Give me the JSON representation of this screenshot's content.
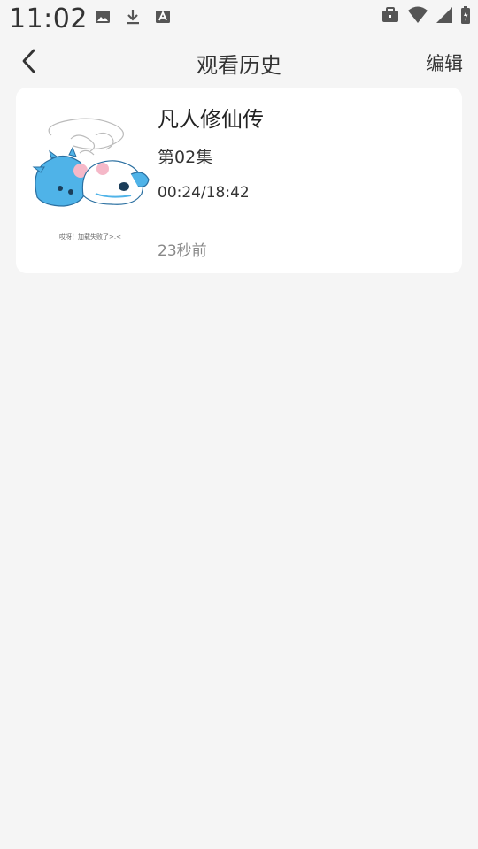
{
  "status_bar": {
    "time": "11:02",
    "left_icons": [
      "image-icon",
      "download-icon",
      "font-icon"
    ],
    "right_icons": [
      "briefcase-icon",
      "wifi-icon",
      "signal-icon",
      "battery-charging-icon"
    ]
  },
  "header": {
    "back_icon": "chevron-left-icon",
    "title": "观看历史",
    "edit_label": "编辑"
  },
  "history": [
    {
      "title": "凡人修仙传",
      "episode": "第02集",
      "progress": "00:24/18:42",
      "watched_ago": "23秒前",
      "thumbnail_caption": "哎呀！加载失败了>.<"
    }
  ],
  "colors": {
    "background": "#f5f5f5",
    "card": "#ffffff",
    "text_primary": "#222222",
    "text_secondary": "#888888",
    "mascot_blue": "#4fb3e8"
  }
}
